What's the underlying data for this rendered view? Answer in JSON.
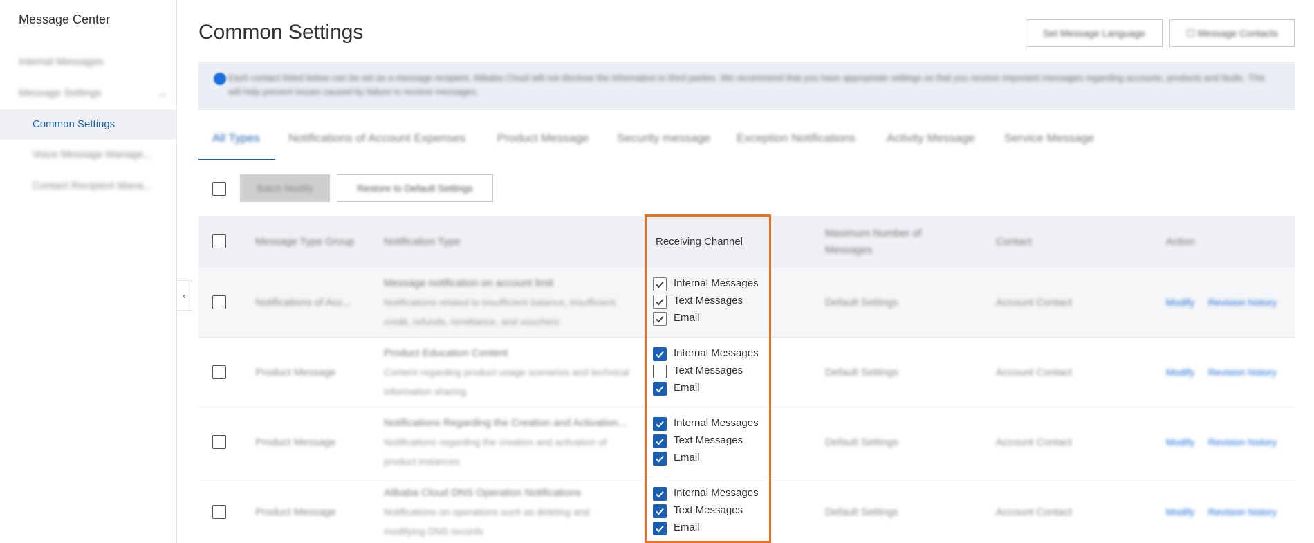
{
  "sidebar": {
    "title": "Message Center",
    "items": [
      {
        "label": "Internal Messages",
        "blurred": true
      },
      {
        "label": "Message Settings",
        "blurred": true
      },
      {
        "label": "Common Settings",
        "blurred": false
      },
      {
        "label": "Voice Message Manage...",
        "blurred": true
      },
      {
        "label": "Contact Recipient Mana...",
        "blurred": true
      }
    ]
  },
  "collapse_glyph": "‹",
  "header": {
    "title": "Common Settings",
    "btn_language": "Set Message Language",
    "btn_contacts": "Message Contacts"
  },
  "notice": {
    "text": "Each contact listed below can be set as a message recipient. Alibaba Cloud will not disclose the information to third parties. We recommend that you have appropriate settings so that you receive important messages regarding accounts, products and faults. This will help prevent issues caused by failure to receive messages."
  },
  "tabs": [
    "All Types",
    "Notifications of Account Expenses",
    "Product Message",
    "Security message",
    "Exception Notifications",
    "Activity Message",
    "Service Message"
  ],
  "toolbar": {
    "batch_label": "Batch Modify",
    "restore_label": "Restore to Default Settings"
  },
  "table": {
    "headers": {
      "group": "Message Type Group",
      "type": "Notification Type",
      "channel": "Receiving Channel",
      "max": "Maximum Number of Messages",
      "contact": "Contact",
      "action": "Action"
    },
    "rows": [
      {
        "group": "Notifications of Acc...",
        "type": "Message notification on account limit",
        "desc": "Notifications related to insufficient balance, insufficient credit, refunds, remittance, and vouchers",
        "channels": [
          {
            "label": "Internal Messages",
            "state": "checked-disabled"
          },
          {
            "label": "Text Messages",
            "state": "checked-disabled"
          },
          {
            "label": "Email",
            "state": "checked-disabled"
          }
        ],
        "max": "Default Settings",
        "contact": "Account Contact",
        "modify": "Modify",
        "history": "Revision history"
      },
      {
        "group": "Product Message",
        "type": "Product Education Content",
        "desc": "Content regarding product usage scenarios and technical information sharing",
        "channels": [
          {
            "label": "Internal Messages",
            "state": "checked"
          },
          {
            "label": "Text Messages",
            "state": "unchecked"
          },
          {
            "label": "Email",
            "state": "checked"
          }
        ],
        "max": "Default Settings",
        "contact": "Account Contact",
        "modify": "Modify",
        "history": "Revision history"
      },
      {
        "group": "Product Message",
        "type": "Notifications Regarding the Creation and Activation...",
        "desc": "Notifications regarding the creation and activation of product instances",
        "channels": [
          {
            "label": "Internal Messages",
            "state": "checked"
          },
          {
            "label": "Text Messages",
            "state": "checked"
          },
          {
            "label": "Email",
            "state": "checked"
          }
        ],
        "max": "Default Settings",
        "contact": "Account Contact",
        "modify": "Modify",
        "history": "Revision history"
      },
      {
        "group": "Product Message",
        "type": "Alibaba Cloud DNS Operation Notifications",
        "desc": "Notifications on operations such as deleting and modifying DNS records",
        "channels": [
          {
            "label": "Internal Messages",
            "state": "checked"
          },
          {
            "label": "Text Messages",
            "state": "checked"
          },
          {
            "label": "Email",
            "state": "checked"
          }
        ],
        "max": "Default Settings",
        "contact": "Account Contact",
        "modify": "Modify",
        "history": "Revision history"
      }
    ]
  },
  "colors": {
    "accent": "#1a60b4",
    "highlight": "#ef6e1e"
  }
}
